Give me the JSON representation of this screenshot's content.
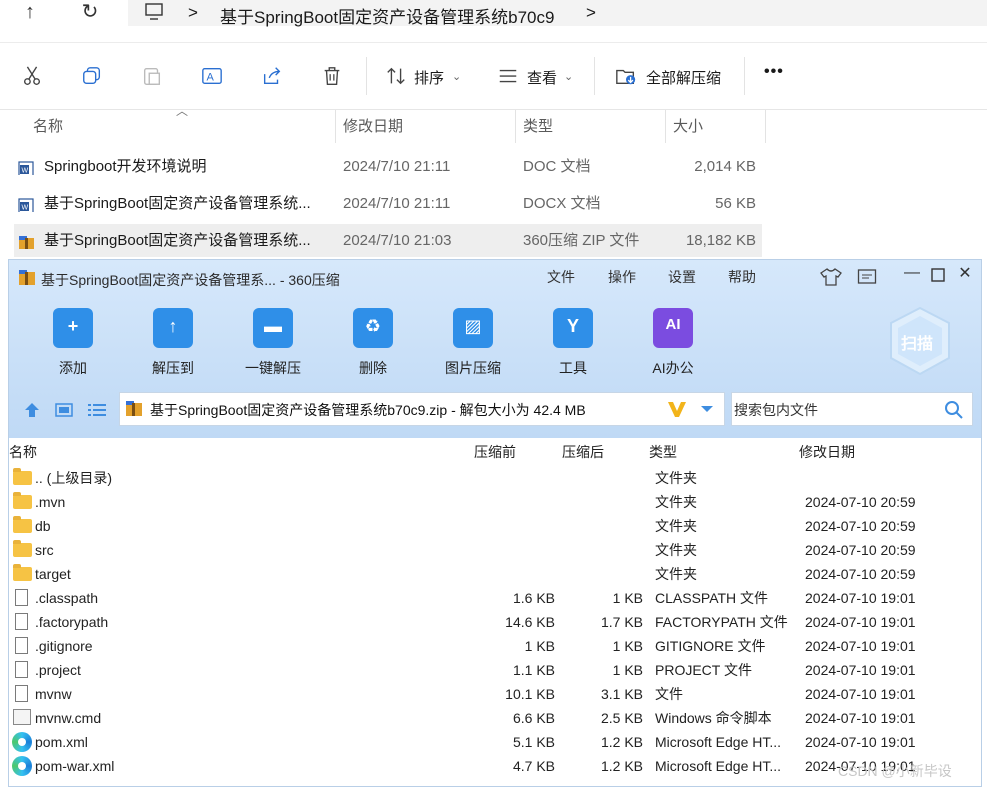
{
  "explorer": {
    "breadcrumb": {
      "separator": ">",
      "folder": "基于SpringBoot固定资产设备管理系统b70c9"
    },
    "toolbar": {
      "sort_label": "排序",
      "view_label": "查看",
      "extract_all_label": "全部解压缩",
      "more_label": "•••"
    },
    "columns": {
      "name": "名称",
      "date": "修改日期",
      "type": "类型",
      "size": "大小"
    },
    "files": [
      {
        "name": "Springboot开发环境说明",
        "date": "2024/7/10 21:11",
        "type": "DOC 文档",
        "size": "2,014 KB",
        "icon": "word-doc-icon"
      },
      {
        "name": "基于SpringBoot固定资产设备管理系统...",
        "date": "2024/7/10 21:11",
        "type": "DOCX 文档",
        "size": "56 KB",
        "icon": "word-docx-icon"
      },
      {
        "name": "基于SpringBoot固定资产设备管理系统...",
        "date": "2024/7/10 21:03",
        "type": "360压缩 ZIP 文件",
        "size": "18,182 KB",
        "icon": "zip-archive-icon",
        "selected": true
      }
    ]
  },
  "zip": {
    "title": "基于SpringBoot固定资产设备管理系... - 360压缩",
    "menu": [
      "文件",
      "操作",
      "设置",
      "帮助"
    ],
    "actions": [
      {
        "label": "添加",
        "icon": "add-icon",
        "color": "#2f8fe8"
      },
      {
        "label": "解压到",
        "icon": "extract-to-icon",
        "color": "#2f8fe8"
      },
      {
        "label": "一键解压",
        "icon": "one-click-extract-icon",
        "color": "#2f8fe8"
      },
      {
        "label": "删除",
        "icon": "delete-icon",
        "color": "#2f8fe8"
      },
      {
        "label": "图片压缩",
        "icon": "image-compress-icon",
        "color": "#2f8fe8"
      },
      {
        "label": "工具",
        "icon": "tools-icon",
        "color": "#2f8fe8"
      },
      {
        "label": "AI办公",
        "icon": "ai-office-icon",
        "color": "#7b4ce0"
      }
    ],
    "scan_label": "扫描",
    "path_text": "基于SpringBoot固定资产设备管理系统b70c9.zip - 解包大小为 42.4 MB",
    "search_placeholder": "搜索包内文件",
    "columns": {
      "name": "名称",
      "before": "压缩前",
      "after": "压缩后",
      "type": "类型",
      "date": "修改日期"
    },
    "rows": [
      {
        "name": ".. (上级目录)",
        "before": "",
        "after": "",
        "type": "文件夹",
        "date": "",
        "kind": "folder"
      },
      {
        "name": ".mvn",
        "before": "",
        "after": "",
        "type": "文件夹",
        "date": "2024-07-10 20:59",
        "kind": "folder"
      },
      {
        "name": "db",
        "before": "",
        "after": "",
        "type": "文件夹",
        "date": "2024-07-10 20:59",
        "kind": "folder"
      },
      {
        "name": "src",
        "before": "",
        "after": "",
        "type": "文件夹",
        "date": "2024-07-10 20:59",
        "kind": "folder"
      },
      {
        "name": "target",
        "before": "",
        "after": "",
        "type": "文件夹",
        "date": "2024-07-10 20:59",
        "kind": "folder"
      },
      {
        "name": ".classpath",
        "before": "1.6 KB",
        "after": "1 KB",
        "type": "CLASSPATH 文件",
        "date": "2024-07-10 19:01",
        "kind": "file"
      },
      {
        "name": ".factorypath",
        "before": "14.6 KB",
        "after": "1.7 KB",
        "type": "FACTORYPATH 文件",
        "date": "2024-07-10 19:01",
        "kind": "file"
      },
      {
        "name": ".gitignore",
        "before": "1 KB",
        "after": "1 KB",
        "type": "GITIGNORE 文件",
        "date": "2024-07-10 19:01",
        "kind": "file"
      },
      {
        "name": ".project",
        "before": "1.1 KB",
        "after": "1 KB",
        "type": "PROJECT 文件",
        "date": "2024-07-10 19:01",
        "kind": "file"
      },
      {
        "name": "mvnw",
        "before": "10.1 KB",
        "after": "3.1 KB",
        "type": "文件",
        "date": "2024-07-10 19:01",
        "kind": "file"
      },
      {
        "name": "mvnw.cmd",
        "before": "6.6 KB",
        "after": "2.5 KB",
        "type": "Windows 命令脚本",
        "date": "2024-07-10 19:01",
        "kind": "cmd"
      },
      {
        "name": "pom.xml",
        "before": "5.1 KB",
        "after": "1.2 KB",
        "type": "Microsoft Edge HT...",
        "date": "2024-07-10 19:01",
        "kind": "edge"
      },
      {
        "name": "pom-war.xml",
        "before": "4.7 KB",
        "after": "1.2 KB",
        "type": "Microsoft Edge HT...",
        "date": "2024-07-10 19:01",
        "kind": "edge"
      }
    ]
  },
  "watermark": "CSDN @小新毕设"
}
